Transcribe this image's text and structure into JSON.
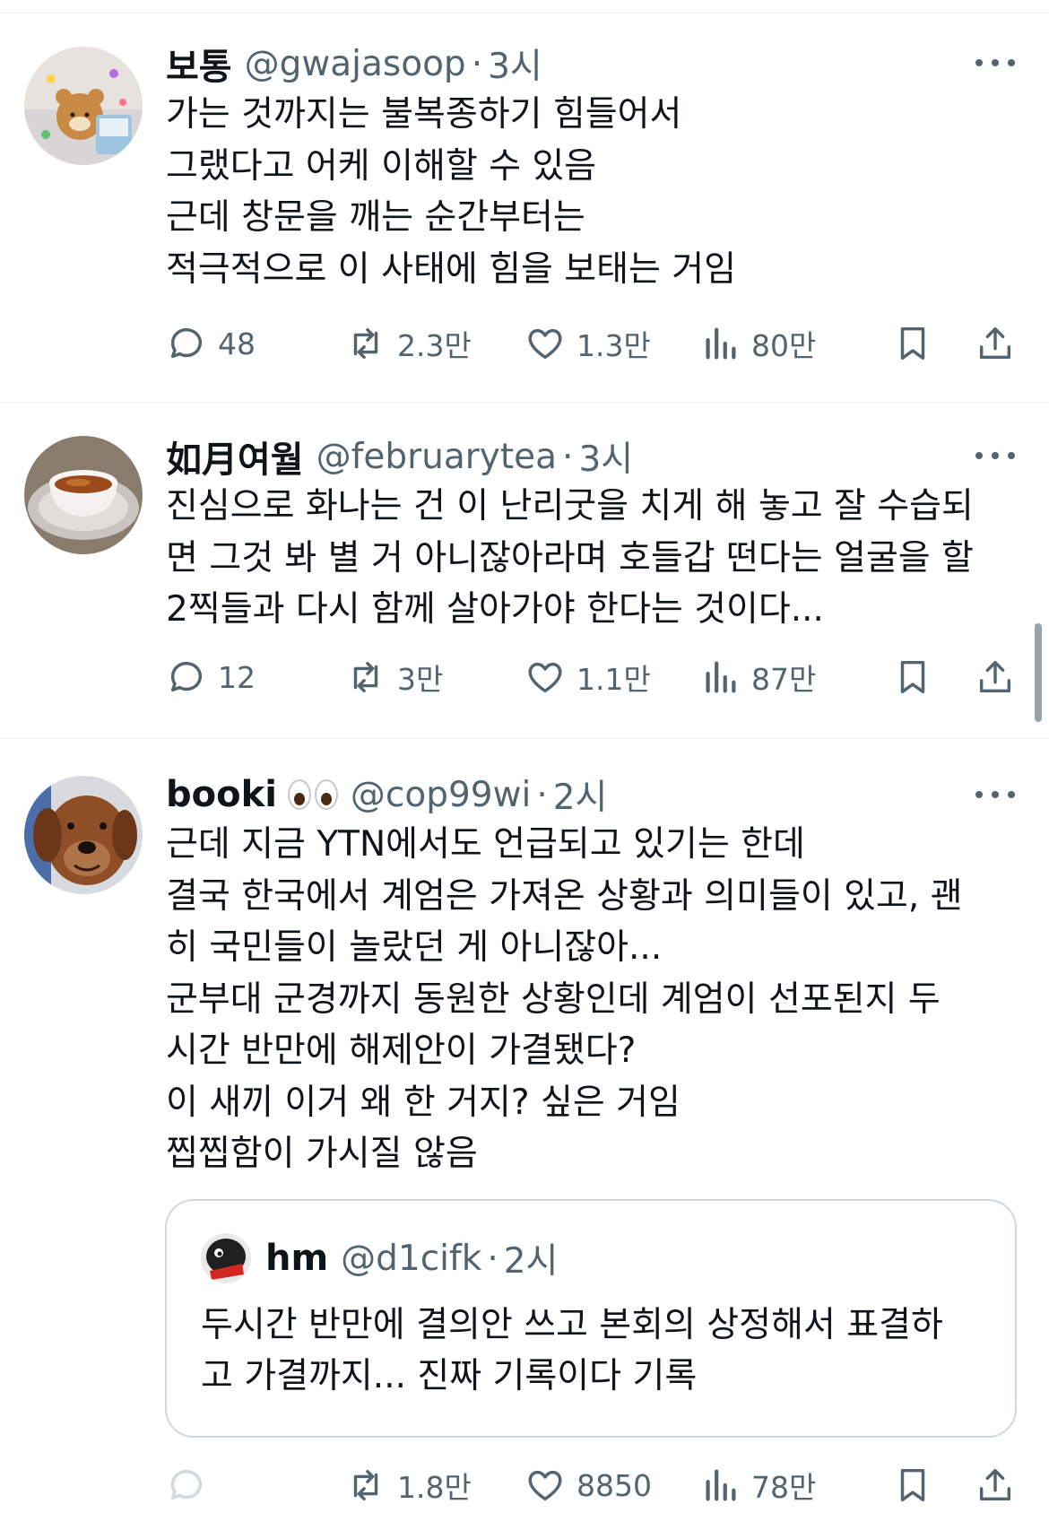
{
  "tweets": [
    {
      "name": "보통",
      "handle": "@gwajasoop",
      "separator": "·",
      "time": "3시",
      "text": [
        "가는 것까지는 불복종하기 힘들어서",
        "그랬다고 어케 이해할 수 있음",
        "근데 창문을 깨는 순간부터는",
        "적극적으로 이 사태에 힘을 보태는 거임"
      ],
      "replies": "48",
      "retweets": "2.3만",
      "likes": "1.3만",
      "views": "80만"
    },
    {
      "name": "如月여월",
      "handle": "@februarytea",
      "separator": "·",
      "time": "3시",
      "text": [
        "진심으로 화나는 건 이 난리굿을 치게 해 놓고 잘 수습되",
        "면 그것 봐 별 거 아니잖아라며 호들갑 떤다는 얼굴을 할",
        "2찍들과 다시 함께 살아가야 한다는 것이다..."
      ],
      "replies": "12",
      "retweets": "3만",
      "likes": "1.1만",
      "views": "87만"
    },
    {
      "name": "booki",
      "emoji": "eyes",
      "handle": "@cop99wi",
      "separator": "·",
      "time": "2시",
      "text": [
        "근데 지금 YTN에서도 언급되고 있기는 한데",
        "결국 한국에서 계엄은 가져온 상황과 의미들이 있고, 괜",
        "히 국민들이 놀랐던 게 아니잖아...",
        "군부대 군경까지 동원한 상황인데 계엄이 선포된지 두",
        "시간 반만에 해제안이 가결됐다?",
        "이 새끼 이거 왜 한 거지? 싶은 거임",
        "찝찝함이 가시질 않음"
      ],
      "quote": {
        "name": "hm",
        "handle": "@d1cifk",
        "separator": "·",
        "time": "2시",
        "text": [
          "두시간 반만에 결의안 쓰고 본회의 상정해서 표결하",
          "고 가결까지... 진짜 기록이다 기록"
        ]
      },
      "replies": "",
      "retweets": "1.8만",
      "likes": "8850",
      "views": "78만"
    }
  ],
  "colors": {
    "text": "#0f1419",
    "secondary": "#536471",
    "divider": "#eff3f4",
    "quote_border": "#cfd9de"
  }
}
